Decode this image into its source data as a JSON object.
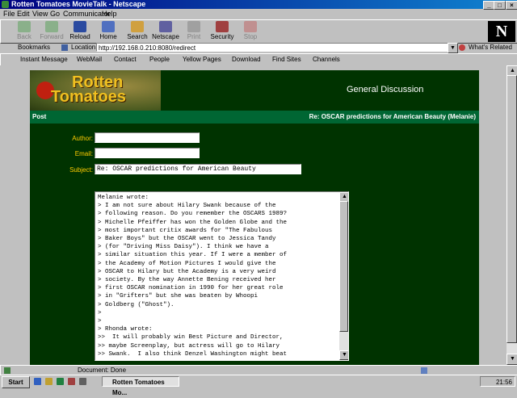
{
  "window": {
    "title": "Rotten Tomatoes MovieTalk - Netscape",
    "controls": [
      "_",
      "□",
      "×"
    ]
  },
  "menu": [
    "File",
    "Edit",
    "View",
    "Go",
    "Communicator",
    "Help"
  ],
  "toolbar": [
    {
      "label": "Back",
      "icon": "back-arrow-icon",
      "enabled": false
    },
    {
      "label": "Forward",
      "icon": "forward-arrow-icon",
      "enabled": false
    },
    {
      "label": "Reload",
      "icon": "reload-icon",
      "enabled": true
    },
    {
      "label": "Home",
      "icon": "home-icon",
      "enabled": true
    },
    {
      "label": "Search",
      "icon": "search-icon",
      "enabled": true
    },
    {
      "label": "Netscape",
      "icon": "netscape-icon",
      "enabled": true
    },
    {
      "label": "Print",
      "icon": "print-icon",
      "enabled": false
    },
    {
      "label": "Security",
      "icon": "security-lock-icon",
      "enabled": true
    },
    {
      "label": "Stop",
      "icon": "stop-icon",
      "enabled": false
    }
  ],
  "brand_logo": "N",
  "location": {
    "bookmarks_label": "Bookmarks",
    "location_label": "Location:",
    "url": "http://192.168.0.210:8080/redirect",
    "whats_related": "What's Related"
  },
  "personal_toolbar": [
    "Instant Message",
    "WebMail",
    "Contact",
    "People",
    "Yellow Pages",
    "Download",
    "Find Sites",
    "Channels"
  ],
  "site": {
    "logo_line1": "Rotten",
    "logo_line2": "Tomatoes",
    "forum_title": "General Discussion",
    "post_label": "Post",
    "post_subject_header": "Re: OSCAR predictions for American Beauty (Melanie)"
  },
  "form": {
    "author_label": "Author:",
    "author_value": "",
    "email_label": "Email:",
    "email_value": "",
    "subject_label": "Subject:",
    "subject_value": "Re: OSCAR predictions for American Beauty",
    "message": "Melanie wrote:\n> I am not sure about Hilary Swank because of the\n> following reason. Do you remember the OSCARS 1989?\n> Michelle Pfeiffer has won the Golden Globe and the\n> most important critix awards for \"The Fabulous\n> Baker Boys\" but the OSCAR went to Jessica Tandy\n> (for \"Driving Miss Daisy\"). I think we have a\n> similar situation this year. If I were a member of\n> the Academy of Motion Pictures I would give the\n> OSCAR to Hilary but the Academy is a very weird\n> society. By the way Annette Bening received her\n> first OSCAR nomination in 1990 for her great role\n> in \"Grifters\" but she was beaten by Whoopi\n> Goldberg (\"Ghost\").\n>\n>\n> Rhonda wrote:\n>>  It will probably win Best Picture and Director,\n>> maybe Screenplay, but actress will go to Hilary\n>> Swank.  I also think Denzel Washington might beat"
  },
  "status": {
    "text": "Document: Done"
  },
  "taskbar": {
    "start": "Start",
    "task": "Rotten Tomatoes Mo...",
    "clock": "21:56"
  },
  "colors": {
    "page_bg": "#003300",
    "post_bar": "#006633",
    "label": "#ffcc00",
    "titlebar": "#000080"
  }
}
